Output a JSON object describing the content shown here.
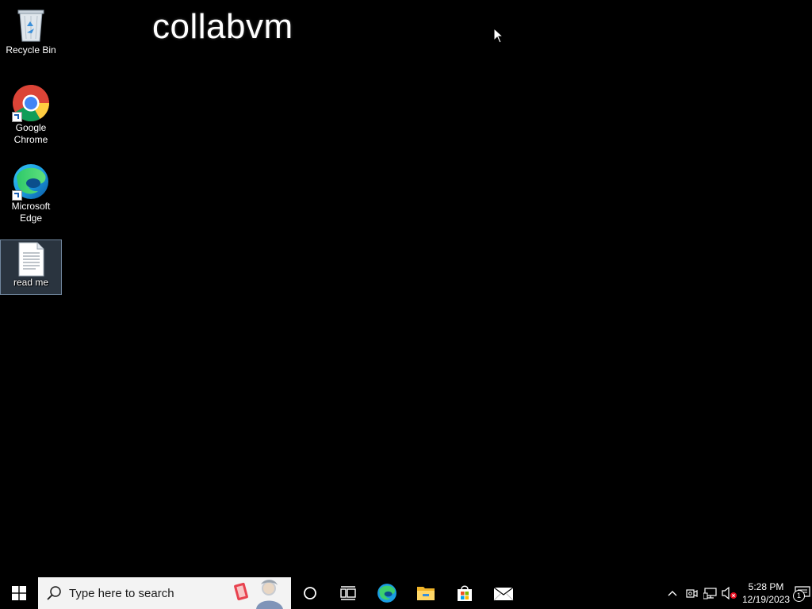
{
  "desktop": {
    "watermark": "collabvm",
    "icons": [
      {
        "label": "Recycle Bin",
        "icon": "recycle-bin-icon"
      },
      {
        "label": "Google\nChrome",
        "icon": "chrome-icon"
      },
      {
        "label": "Microsoft\nEdge",
        "icon": "edge-icon"
      },
      {
        "label": "read me",
        "icon": "text-document-icon"
      }
    ]
  },
  "taskbar": {
    "start_icon": "windows-logo-icon",
    "search": {
      "placeholder": "Type here to search"
    },
    "pinned_apps": [
      "cortana-icon",
      "task-view-icon",
      "edge-icon",
      "file-explorer-icon",
      "store-icon",
      "mail-icon"
    ],
    "tray": {
      "icons": [
        "chevron-up-icon",
        "meet-now-icon",
        "network-icon",
        "volume-muted-icon"
      ],
      "time": "5:28 PM",
      "date": "12/19/2023",
      "notification_count": "1"
    }
  },
  "colors": {
    "desktop_bg": "#000000",
    "taskbar_bg": "#000000",
    "search_bg": "#f3f3f3"
  }
}
